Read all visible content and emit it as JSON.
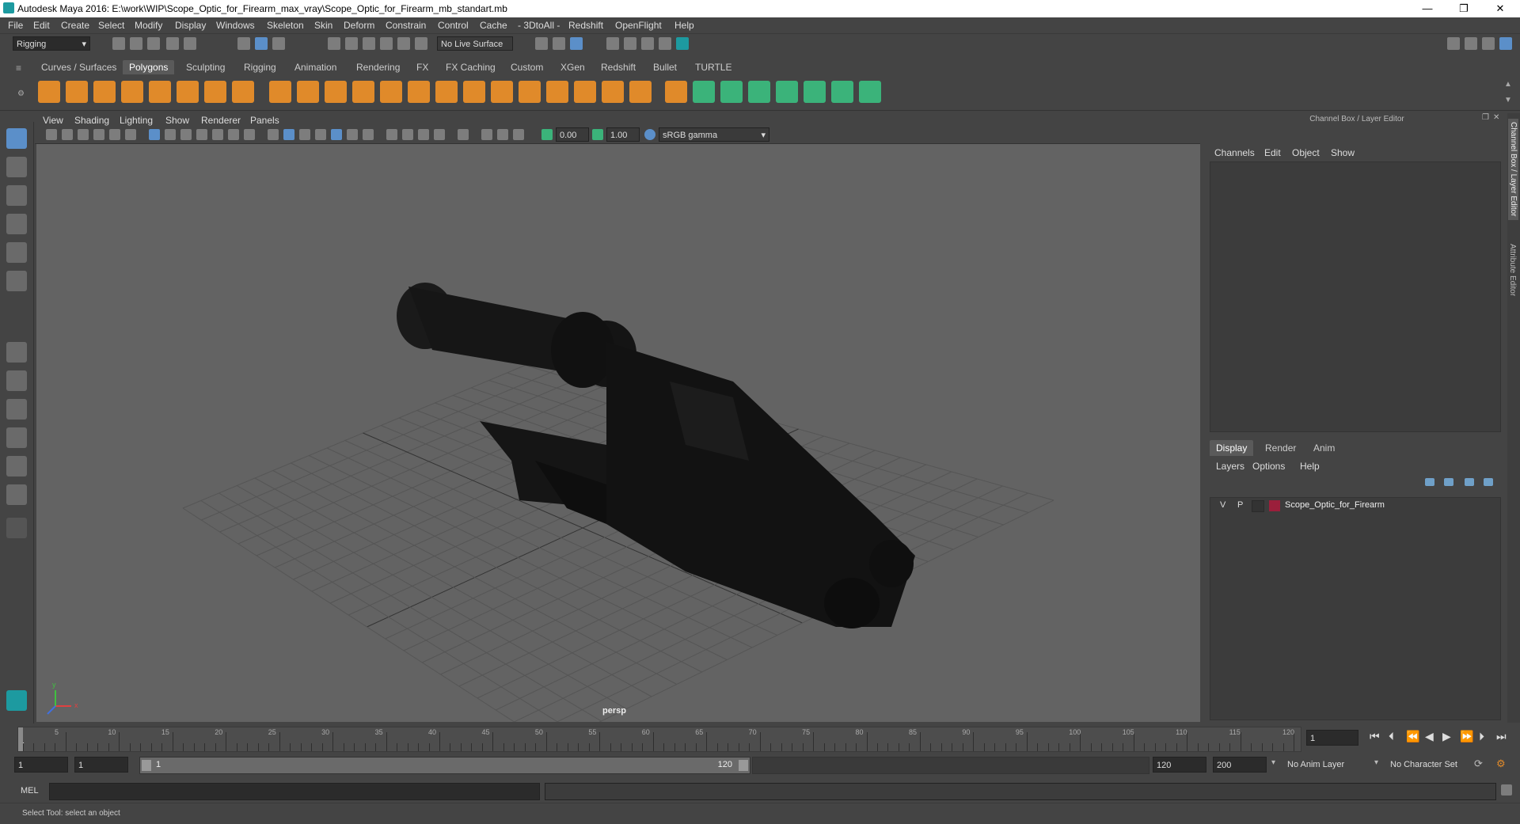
{
  "window": {
    "title": "Autodesk Maya 2016: E:\\work\\WIP\\Scope_Optic_for_Firearm_max_vray\\Scope_Optic_for_Firearm_mb_standart.mb",
    "minimize": "—",
    "restore": "❐",
    "close": "✕"
  },
  "menubar": [
    "File",
    "Edit",
    "Create",
    "Select",
    "Modify",
    "Display",
    "Windows",
    "Skeleton",
    "Skin",
    "Deform",
    "Constrain",
    "Control",
    "Cache",
    "- 3DtoAll -",
    "Redshift",
    "OpenFlight",
    "Help"
  ],
  "statusline": {
    "mode": "Rigging",
    "live_surface": "No Live Surface"
  },
  "shelf_tabs": [
    "Curves / Surfaces",
    "Polygons",
    "Sculpting",
    "Rigging",
    "Animation",
    "Rendering",
    "FX",
    "FX Caching",
    "Custom",
    "XGen",
    "Redshift",
    "Bullet",
    "TURTLE"
  ],
  "active_shelf_tab": "Polygons",
  "viewport": {
    "menu": [
      "View",
      "Shading",
      "Lighting",
      "Show",
      "Renderer",
      "Panels"
    ],
    "gamma_value_1": "0.00",
    "gamma_value_2": "1.00",
    "colorspace": "sRGB gamma",
    "camera_label": "persp",
    "axis_x": "x",
    "axis_y": "y"
  },
  "channel_box": {
    "title": "Channel Box / Layer Editor",
    "menu": [
      "Channels",
      "Edit",
      "Object",
      "Show"
    ]
  },
  "layer_editor": {
    "tabs": [
      "Display",
      "Render",
      "Anim"
    ],
    "active_tab": "Display",
    "menu": [
      "Layers",
      "Options",
      "Help"
    ],
    "layers": [
      {
        "v": "V",
        "p": "P",
        "color": "#9b1f3b",
        "name": "Scope_Optic_for_Firearm"
      }
    ]
  },
  "side_tabs": [
    "Channel Box / Layer Editor",
    "Attribute Editor"
  ],
  "timeline": {
    "ticks": [
      "5",
      "10",
      "15",
      "20",
      "25",
      "30",
      "35",
      "40",
      "45",
      "50",
      "55",
      "60",
      "65",
      "70",
      "75",
      "80",
      "85",
      "90",
      "95",
      "100",
      "105",
      "110",
      "115",
      "120"
    ],
    "start_tick": "1",
    "current_frame": "1",
    "current_frame_field": "1"
  },
  "range": {
    "start": "1",
    "playback_start": "1",
    "slider_start": "1",
    "slider_end": "120",
    "playback_end": "120",
    "end": "200",
    "anim_layer": "No Anim Layer",
    "character_set": "No Character Set"
  },
  "command_line": {
    "label": "MEL"
  },
  "help_line": "Select Tool: select an object",
  "colors": {
    "accent_teal": "#1d9aa0",
    "poly_orange": "#e08a2a",
    "green_icon": "#3bb37a",
    "highlight_blue": "#5b8fc9"
  }
}
